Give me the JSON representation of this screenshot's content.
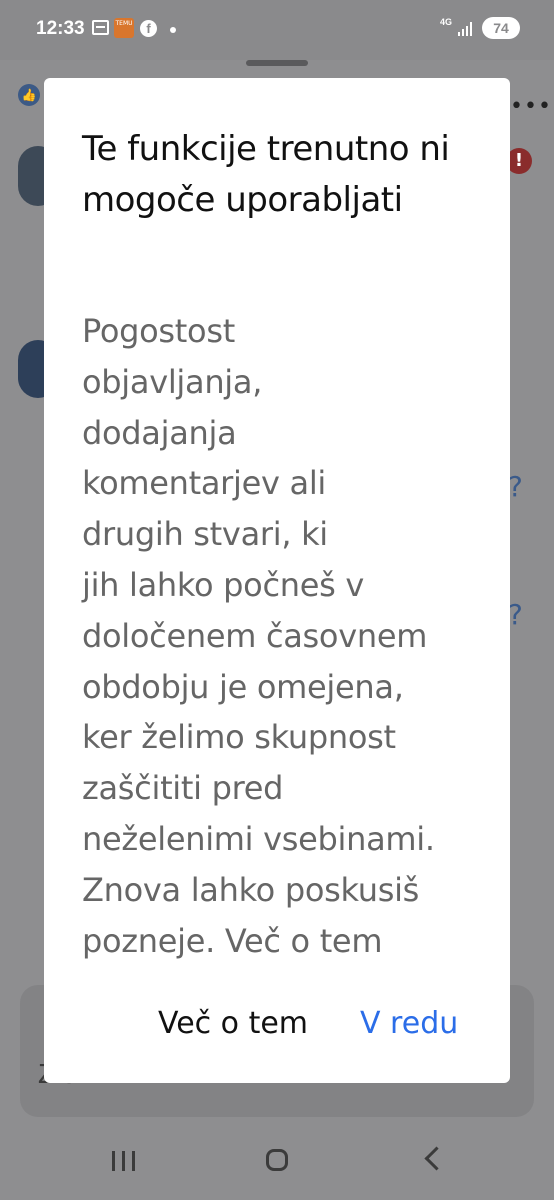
{
  "status_bar": {
    "time": "12:33",
    "temu_label": "TEMU",
    "facebook_glyph": "f",
    "network": "4G",
    "battery": "74"
  },
  "dialog": {
    "title": "Te funkcije trenutno ni mogoče uporabljati",
    "body": "Pogostost\nobjavljanja,\ndodajanja\nkomentarjev ali\ndrugih stvari, ki\njih lahko počneš v\ndoločenem časovnem\nobdobju je omejena,\nker želimo skupnost\nzaščititi pred\nneželenimi vsebinami.\nZnova lahko poskusiš\npozneje. Več o tem",
    "more_button": "Več o tem",
    "ok_button": "V redu"
  },
  "background": {
    "card_text": "Zložnik"
  },
  "colors": {
    "accent": "#2b6de8",
    "scrim": "#8e8e90"
  },
  "icons": [
    "calendar-icon",
    "temu-app-icon",
    "facebook-icon",
    "signal-icon",
    "battery-icon",
    "recent-apps-icon",
    "home-icon",
    "back-icon"
  ]
}
